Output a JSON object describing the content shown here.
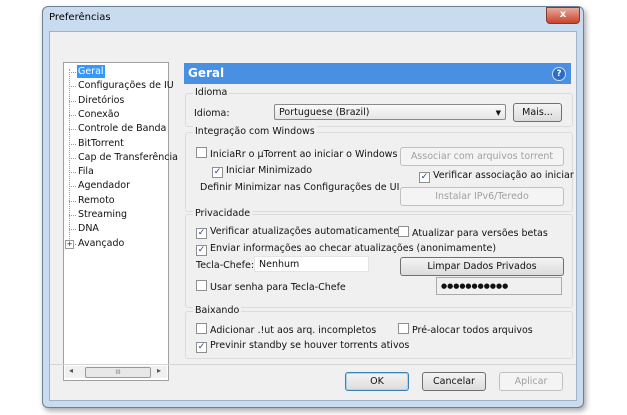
{
  "window": {
    "title": "Preferências",
    "close": "x"
  },
  "tree": {
    "items": [
      "Geral",
      "Configurações de IU",
      "Diretórios",
      "Conexão",
      "Controle de Banda",
      "BitTorrent",
      "Cap de Transferência",
      "Fila",
      "Agendador",
      "Remoto",
      "Streaming",
      "DNA",
      "Avançado"
    ],
    "selected": "Geral",
    "scroll_left": "◂",
    "scroll_right": "▸",
    "scroll_thumb": "III"
  },
  "header": {
    "title": "Geral",
    "help": "?"
  },
  "idioma": {
    "group": "Idioma",
    "label": "Idioma:",
    "value": "Portuguese (Brazil)",
    "more": "Mais..."
  },
  "windows": {
    "group": "Integração com Windows",
    "start": "IniciaRr o µTorrent ao iniciar o Windows",
    "start_checked": false,
    "minimized": "Iniciar Minimizado",
    "minimized_checked": true,
    "minimize_note": "Definir Minimizar nas Configurações de UI",
    "associate": "Associar com arquivos torrent",
    "verify": "Verificar associação ao iniciar",
    "verify_checked": true,
    "ipv6": "Instalar IPv6/Teredo"
  },
  "privacy": {
    "group": "Privacidade",
    "auto_update": "Verificar atualizações automaticamente",
    "auto_update_checked": true,
    "beta": "Atualizar para versões betas",
    "beta_checked": false,
    "send_info": "Enviar informações ao checar atualizações (anonimamente)",
    "send_info_checked": true,
    "boss_key_label": "Tecla-Chefe:",
    "boss_key_value": "Nenhum",
    "clear": "Limpar Dados Privados",
    "use_password": "Usar senha para Tecla-Chefe",
    "use_password_checked": false,
    "password": "●●●●●●●●●●●"
  },
  "download": {
    "group": "Baixando",
    "append_ut": "Adicionar .!ut aos arq. incompletos",
    "append_ut_checked": false,
    "prealloc": "Pré-alocar todos arquivos",
    "prealloc_checked": false,
    "standby": "Previnir standby se houver torrents ativos",
    "standby_checked": true
  },
  "buttons": {
    "ok": "OK",
    "cancel": "Cancelar",
    "apply": "Aplicar"
  },
  "check_mark": "✓"
}
